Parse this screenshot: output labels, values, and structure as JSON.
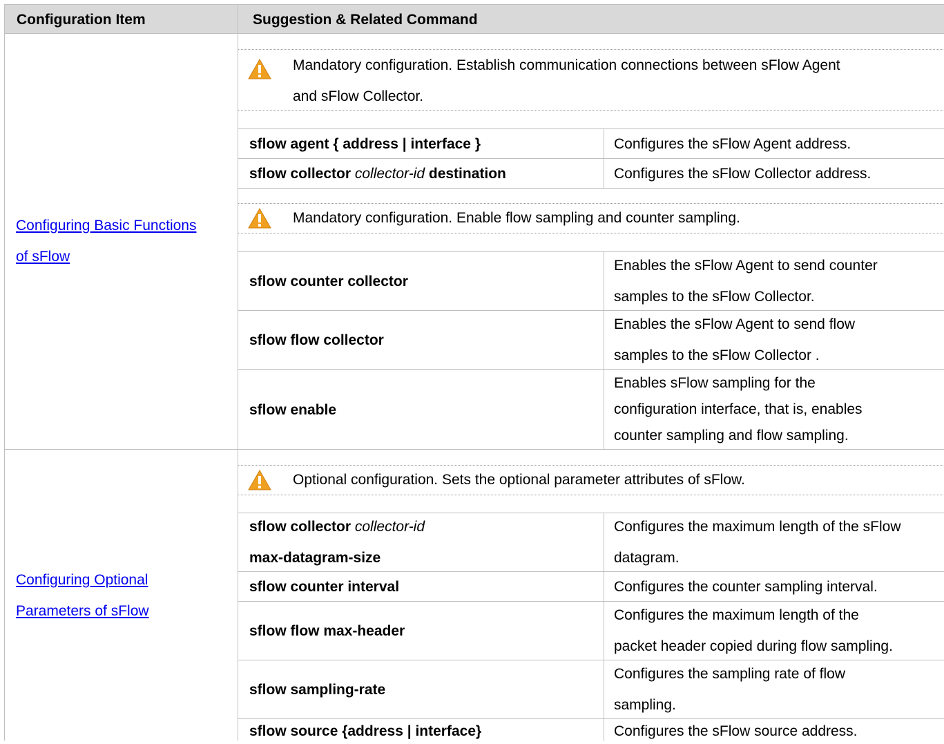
{
  "table": {
    "header": {
      "item": "Configuration Item",
      "suggestion": "Suggestion & Related Command"
    },
    "sections": [
      {
        "item_line1": "Configuring Basic Functions ",
        "item_line2": "of sFlow",
        "notice1": {
          "icon": "warning-icon",
          "line1": "Mandatory configuration. Establish communication connections between sFlow Agent",
          "line2": "and sFlow Collector."
        },
        "rows1": [
          {
            "cmd_bold": "sflow agent { address | interface }",
            "desc": "Configures the sFlow Agent address."
          },
          {
            "cmd_bold": "sflow collector ",
            "cmd_italic": "collector-id",
            "cmd_bold2": " destination",
            "desc": "Configures the sFlow Collector address."
          }
        ],
        "notice2": {
          "icon": "warning-icon",
          "line1": "Mandatory configuration. Enable flow sampling and counter sampling."
        },
        "rows2": [
          {
            "cmd_bold": "sflow counter collector",
            "desc1": "Enables the sFlow Agent to send counter",
            "desc2": "samples to the sFlow Collector."
          },
          {
            "cmd_bold": "sflow flow collector",
            "desc1": "Enables the sFlow Agent to send flow",
            "desc2": "samples to the sFlow Collector ."
          },
          {
            "cmd_bold": "sflow enable",
            "desc1": "Enables sFlow sampling for the",
            "desc2": "configuration interface, that is, enables",
            "desc3": "counter sampling and flow sampling."
          }
        ]
      },
      {
        "item_line1": "Configuring Optional ",
        "item_line2": "Parameters of sFlow",
        "notice1": {
          "icon": "warning-icon",
          "line1": "Optional configuration. Sets the optional parameter attributes of sFlow."
        },
        "rows1": [
          {
            "cmd_bold": "sflow collector ",
            "cmd_italic": "collector-id",
            "cmd_line2": "max-datagram-size",
            "desc1": "Configures the maximum length of the sFlow",
            "desc2": "datagram."
          },
          {
            "cmd_bold": "sflow counter interval",
            "desc": "Configures the counter sampling interval."
          },
          {
            "cmd_bold": "sflow flow max-header",
            "desc1": "Configures the maximum length of the",
            "desc2": "packet header copied during flow sampling."
          },
          {
            "cmd_bold": "sflow sampling-rate",
            "desc1": "Configures the sampling rate of flow",
            "desc2": "sampling."
          },
          {
            "cmd_bold": "sflow source {address | interface}",
            "desc": "Configures the sFlow source address."
          }
        ]
      }
    ],
    "colors": {
      "header_bg": "#d9d9d9",
      "border": "#bfbfbf",
      "link": "#0000ee",
      "warning": "#f0a020"
    }
  }
}
